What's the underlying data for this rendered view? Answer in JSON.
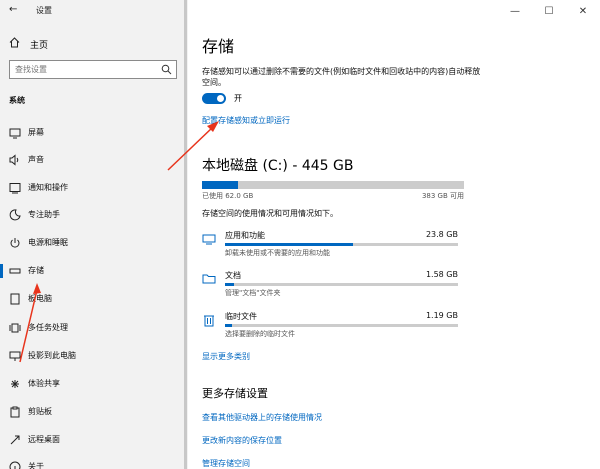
{
  "window": {
    "title": "设置",
    "controls": [
      "—",
      "☐",
      "✕"
    ]
  },
  "sidebar": {
    "home_label": "主页",
    "search_placeholder": "查找设置",
    "section_label": "系统",
    "items": [
      {
        "label": "屏幕",
        "icon": "monitor-icon"
      },
      {
        "label": "声音",
        "icon": "speaker-icon"
      },
      {
        "label": "通知和操作",
        "icon": "notification-icon"
      },
      {
        "label": "专注助手",
        "icon": "moon-icon"
      },
      {
        "label": "电源和睡眠",
        "icon": "power-icon"
      },
      {
        "label": "存储",
        "icon": "storage-icon",
        "active": true
      },
      {
        "label": "板电脑",
        "icon": "tablet-icon"
      },
      {
        "label": "多任务处理",
        "icon": "multitask-icon"
      },
      {
        "label": "投影到此电脑",
        "icon": "projector-icon"
      },
      {
        "label": "体验共享",
        "icon": "share-icon"
      },
      {
        "label": "剪贴板",
        "icon": "clipboard-icon"
      },
      {
        "label": "远程桌面",
        "icon": "remote-desktop-icon"
      },
      {
        "label": "关于",
        "icon": "info-icon"
      }
    ]
  },
  "main": {
    "title": "存储",
    "storage_sense_desc": "存储感知可以通过删除不需要的文件(例如临时文件和回收站中的内容)自动释放空间。",
    "toggle_label": "开",
    "toggle_on": true,
    "configure_link": "配置存储感知或立即运行",
    "drive_title": "本地磁盘 (C:) - 445 GB",
    "used_label": "已使用 62.0 GB",
    "free_label": "383 GB 可用",
    "used_fraction": 0.139,
    "usage_info": "存储空间的使用情况和可用情况如下。",
    "categories": [
      {
        "name": "应用和功能",
        "size": "23.8 GB",
        "desc": "卸载未使用或不需要的应用和功能",
        "fraction": 0.55,
        "icon": "apps-icon"
      },
      {
        "name": "文档",
        "size": "1.58 GB",
        "desc": "管理\"文档\"文件夹",
        "fraction": 0.04,
        "icon": "folder-icon"
      },
      {
        "name": "临时文件",
        "size": "1.19 GB",
        "desc": "选择要删除的临时文件",
        "fraction": 0.03,
        "icon": "trash-icon"
      }
    ],
    "show_more_link": "显示更多类别",
    "more_settings_title": "更多存储设置",
    "more_links": [
      "查看其他驱动器上的存储使用情况",
      "更改新内容的保存位置",
      "管理存储空间"
    ]
  },
  "colors": {
    "accent": "#0067c0",
    "annotation": "#e8341c"
  }
}
